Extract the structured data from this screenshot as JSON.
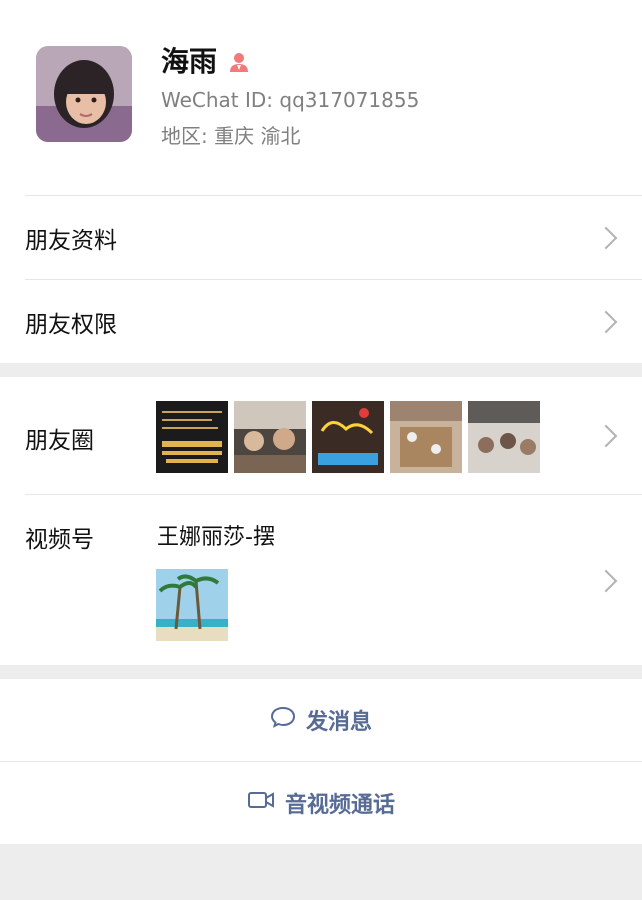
{
  "profile": {
    "name": "海雨",
    "wechat_id": "WeChat ID: qq317071855",
    "region": "地区: 重庆 渝北",
    "gender_icon": "female-icon",
    "gender_color": "#fa5151"
  },
  "menu": {
    "friend_profile": "朋友资料",
    "friend_permissions": "朋友权限"
  },
  "moments": {
    "label": "朋友圈",
    "thumbnails": [
      "moment-photo-menu",
      "moment-photo-dining",
      "moment-photo-neon-sign",
      "moment-photo-restaurant",
      "moment-photo-crowd"
    ]
  },
  "channels": {
    "label": "视频号",
    "title": "王娜丽莎-摆",
    "thumbnail": "palm-beach-photo"
  },
  "actions": {
    "send_message": "发消息",
    "video_call": "音视频通话"
  },
  "colors": {
    "link": "#576b95",
    "background": "#ededed",
    "secondary_text": "#808080"
  }
}
